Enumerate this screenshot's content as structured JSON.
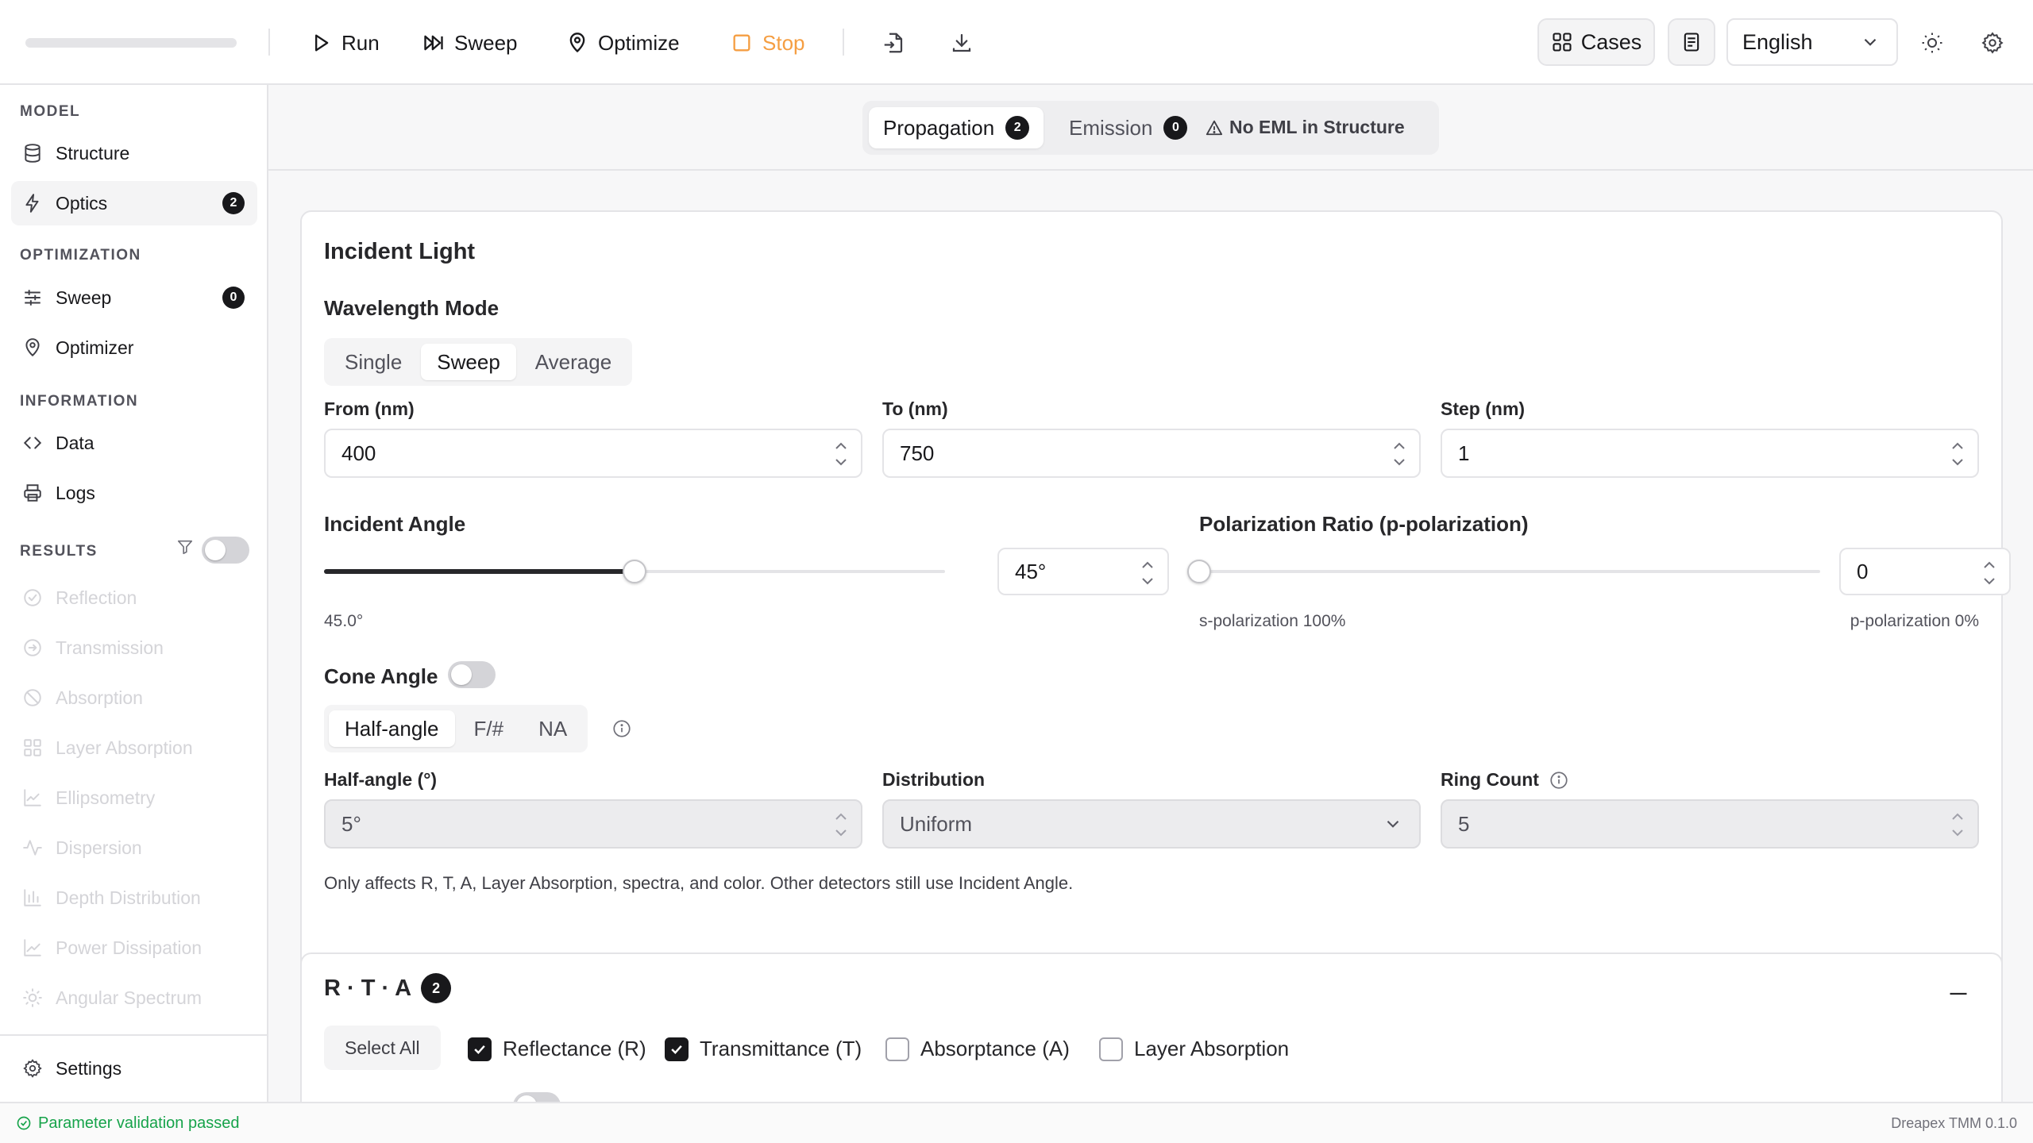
{
  "toolbar": {
    "run": "Run",
    "sweep": "Sweep",
    "optimize": "Optimize",
    "stop": "Stop",
    "cases": "Cases",
    "language": "English",
    "stop_color": "#f59e42"
  },
  "sidebar": {
    "model_heading": "MODEL",
    "structure": "Structure",
    "optics": "Optics",
    "optics_count": "2",
    "optimization_heading": "OPTIMIZATION",
    "sweep": "Sweep",
    "sweep_count": "0",
    "optimizer": "Optimizer",
    "information_heading": "INFORMATION",
    "data": "Data",
    "logs": "Logs",
    "results_heading": "RESULTS",
    "results": [
      {
        "label": "Reflection",
        "icon": "circle-check-icon"
      },
      {
        "label": "Transmission",
        "icon": "circle-arrow-icon"
      },
      {
        "label": "Absorption",
        "icon": "circle-slash-icon"
      },
      {
        "label": "Layer Absorption",
        "icon": "layout-grid-icon"
      },
      {
        "label": "Ellipsometry",
        "icon": "chart-line-icon"
      },
      {
        "label": "Dispersion",
        "icon": "activity-icon"
      },
      {
        "label": "Depth Distribution",
        "icon": "bar-chart-icon"
      },
      {
        "label": "Power Dissipation",
        "icon": "trend-icon"
      },
      {
        "label": "Angular Spectrum",
        "icon": "sun-icon"
      }
    ],
    "settings": "Settings"
  },
  "subtabs": {
    "propagation": "Propagation",
    "propagation_count": "2",
    "emission": "Emission",
    "emission_count": "0",
    "warning": "No EML in Structure"
  },
  "incident": {
    "title": "Incident Light",
    "wavelength_mode_label": "Wavelength Mode",
    "modes": [
      "Single",
      "Sweep",
      "Average"
    ],
    "selected_mode": "Sweep",
    "from_label": "From (nm)",
    "from_value": "400",
    "to_label": "To (nm)",
    "to_value": "750",
    "step_label": "Step (nm)",
    "step_value": "1",
    "angle_label": "Incident Angle",
    "angle_input": "45°",
    "angle_readout": "45.0°",
    "angle_fraction": 0.5,
    "pol_label": "Polarization Ratio (p-polarization)",
    "pol_input": "0",
    "pol_fraction": 0,
    "s_pol_text": "s-polarization 100%",
    "p_pol_text": "p-polarization 0%",
    "cone_label": "Cone Angle",
    "cone_modes": [
      "Half-angle",
      "F/#",
      "NA"
    ],
    "selected_cone_mode": "Half-angle",
    "half_angle_label": "Half-angle (°)",
    "half_angle_value": "5°",
    "distribution_label": "Distribution",
    "distribution_value": "Uniform",
    "ring_label": "Ring Count",
    "ring_value": "5",
    "note": "Only affects R, T, A, Layer Absorption, spectra, and color. Other detectors still use Incident Angle."
  },
  "rta": {
    "title": "R · T · A",
    "count": "2",
    "select_all": "Select All",
    "options": [
      {
        "label": "Reflectance (R)",
        "checked": true
      },
      {
        "label": "Transmittance (T)",
        "checked": true
      },
      {
        "label": "Absorptance (A)",
        "checked": false
      },
      {
        "label": "Layer Absorption",
        "checked": false
      }
    ]
  },
  "status": {
    "message": "Parameter validation passed",
    "version": "Dreapex TMM 0.1.0"
  }
}
